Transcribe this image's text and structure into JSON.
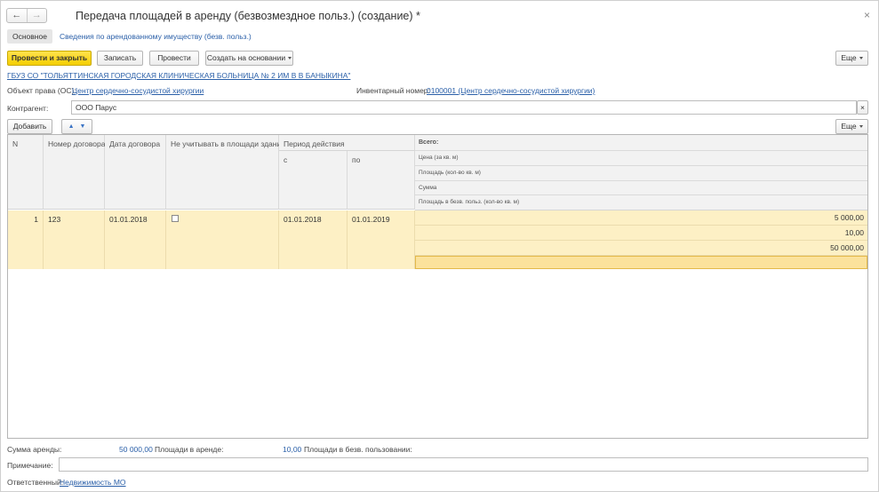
{
  "window": {
    "title": "Передача площадей в аренду (безвозмездное польз.) (создание) *",
    "back": "←",
    "forward": "→",
    "close": "×"
  },
  "tabs": {
    "main": "Основное",
    "info": "Сведения по арендованному имуществу (безв. польз.)"
  },
  "toolbar": {
    "post_close": "Провести и закрыть",
    "save": "Записать",
    "post": "Провести",
    "create_based": "Создать на основании",
    "more": "Еще"
  },
  "org_link": "ГБУЗ СО \"ТОЛЬЯТТИНСКАЯ ГОРОДСКАЯ КЛИНИЧЕСКАЯ БОЛЬНИЦА № 2 ИМ В В БАНЫКИНА\"",
  "object": {
    "label": "Объект права (ОС):",
    "value": "Центр сердечно-сосудистой хирургии",
    "inv_label": "Инвентарный номер:",
    "inv_value": "0100001 (Центр сердечно-сосудистой хирургии)"
  },
  "counterparty": {
    "label": "Контрагент:",
    "value": "ООО Парус",
    "clear": "×"
  },
  "table_toolbar": {
    "add": "Добавить",
    "up": "▲",
    "down": "▼",
    "more": "Еще"
  },
  "table": {
    "headers": {
      "n": "N",
      "contract_no": "Номер договора",
      "contract_date": "Дата договора",
      "exclude": "Не учитывать в площади здания",
      "period": "Период действия",
      "from": "с",
      "to": "по",
      "total": "Всего:",
      "price": "Цена (за кв. м)",
      "area": "Площадь (кол-во кв. м)",
      "sum": "Сумма",
      "free_area": "Площадь в безв. польз. (кол-во кв. м)"
    },
    "rows": [
      {
        "n": "1",
        "contract_no": "123",
        "contract_date": "01.01.2018",
        "exclude": false,
        "from": "01.01.2018",
        "to": "01.01.2019",
        "price": "5 000,00",
        "area": "10,00",
        "sum": "50 000,00",
        "free_area": ""
      }
    ]
  },
  "footer": {
    "rent_sum_label": "Сумма аренды:",
    "rent_sum_value": "50 000,00",
    "rent_area_label": "Площади в аренде:",
    "rent_area_value": "10,00",
    "free_area_label": "Площади в безв. пользовании:",
    "note_label": "Примечание:",
    "note_value": "",
    "responsible_label": "Ответственный:",
    "responsible_value": "Недвижимость МО"
  }
}
